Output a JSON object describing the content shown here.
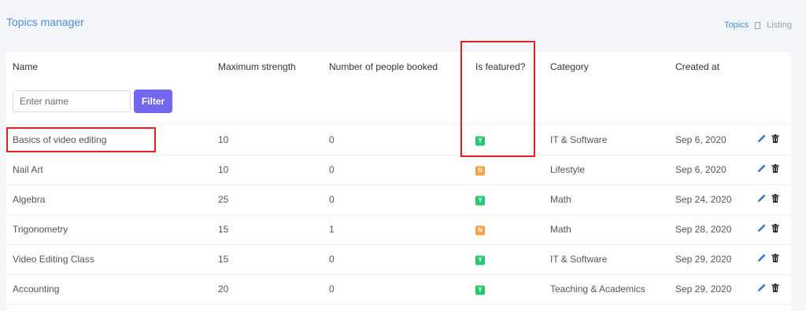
{
  "header": {
    "title": "Topics manager"
  },
  "breadcrumb": {
    "link": "Topics",
    "current": "Listing"
  },
  "table": {
    "columns": [
      "Name",
      "Maximum strength",
      "Number of people booked",
      "Is featured?",
      "Category",
      "Created at"
    ],
    "filter": {
      "placeholder": "Enter name",
      "value": "",
      "button_label": "Filter"
    },
    "rows": [
      {
        "name": "Basics of video editing",
        "max_strength": "10",
        "booked": "0",
        "featured": "Y",
        "category": "IT & Software",
        "created_at": "Sep 6, 2020"
      },
      {
        "name": "Nail Art",
        "max_strength": "10",
        "booked": "0",
        "featured": "N",
        "category": "Lifestyle",
        "created_at": "Sep 6, 2020"
      },
      {
        "name": "Algebra",
        "max_strength": "25",
        "booked": "0",
        "featured": "Y",
        "category": "Math",
        "created_at": "Sep 24, 2020"
      },
      {
        "name": "Trigonometry",
        "max_strength": "15",
        "booked": "1",
        "featured": "N",
        "category": "Math",
        "created_at": "Sep 28, 2020"
      },
      {
        "name": "Video Editing Class",
        "max_strength": "15",
        "booked": "0",
        "featured": "Y",
        "category": "IT & Software",
        "created_at": "Sep 29, 2020"
      },
      {
        "name": "Accounting",
        "max_strength": "20",
        "booked": "0",
        "featured": "Y",
        "category": "Teaching & Academics",
        "created_at": "Sep 29, 2020"
      }
    ],
    "row_action_icons": [
      "pencil-icon",
      "trash-icon"
    ]
  },
  "colors": {
    "accent": "#4a8fd9",
    "filter_button": "#7367f0",
    "featured_yes": "#28c76f",
    "featured_no": "#ff9f43",
    "highlight": "#e52020"
  }
}
